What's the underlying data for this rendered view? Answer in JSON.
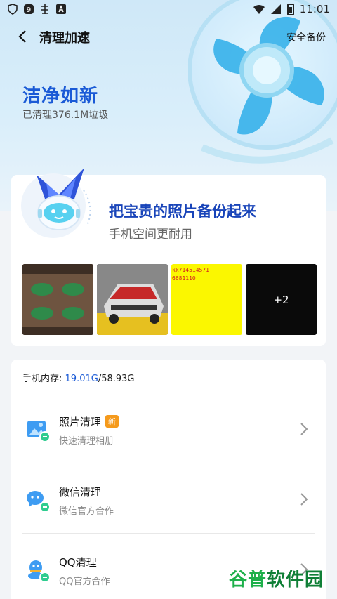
{
  "status_bar": {
    "time": "11:01"
  },
  "header": {
    "title": "清理加速",
    "backup_link": "安全备份"
  },
  "hero": {
    "title": "洁净如新",
    "subtitle": "已清理376.1M垃圾"
  },
  "backup_card": {
    "title": "把宝贵的照片备份起来",
    "subtitle": "手机空间更耐用",
    "thumb_text": [
      "kk714514571",
      "6681110"
    ],
    "more_count": "+2"
  },
  "storage": {
    "label": "手机内存:",
    "used": "19.01G",
    "total": "/58.93G"
  },
  "rows": [
    {
      "title": "照片清理",
      "badge": "新",
      "subtitle": "快速清理相册"
    },
    {
      "title": "微信清理",
      "subtitle": "微信官方合作"
    },
    {
      "title": "QQ清理",
      "subtitle": "QQ官方合作"
    }
  ],
  "watermark": {
    "part1": "谷普",
    "part2": "软件园"
  },
  "colors": {
    "accent": "#1a5ad6",
    "badge": "#f59a1c",
    "title_blue": "#1844b9"
  }
}
